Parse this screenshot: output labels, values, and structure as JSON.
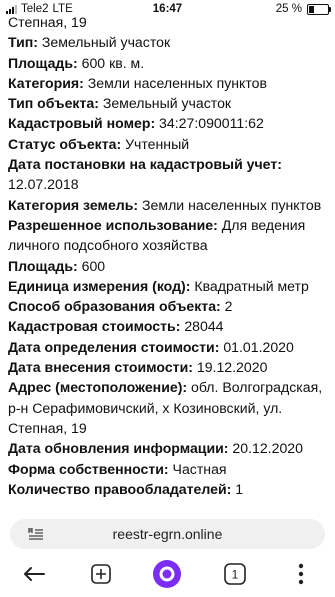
{
  "status_bar": {
    "carrier": "Tele2",
    "network": "LTE",
    "time": "16:47",
    "battery": "25 %",
    "battery_level": 0.25
  },
  "fields": [
    {
      "label": "",
      "value": "Степная, 19"
    },
    {
      "label": "Тип:",
      "value": " Земельный участок"
    },
    {
      "label": "Площадь:",
      "value": " 600 кв. м."
    },
    {
      "label": "Категория:",
      "value": " Земли населенных пунктов"
    },
    {
      "label": "Тип объекта:",
      "value": " Земельный участок"
    },
    {
      "label": "Кадастровый номер:",
      "value": " 34:27:090011:62"
    },
    {
      "label": "Статус объекта:",
      "value": " Учтенный"
    },
    {
      "label": "Дата постановки на кадастровый учет:",
      "value": " 12.07.2018"
    },
    {
      "label": "Категория земель:",
      "value": " Земли населенных пунктов"
    },
    {
      "label": "Разрешенное использование:",
      "value": " Для ведения личного подсобного хозяйства"
    },
    {
      "label": "Площадь:",
      "value": " 600"
    },
    {
      "label": "Единица измерения (код):",
      "value": " Квадратный метр"
    },
    {
      "label": "Способ образования объекта:",
      "value": " 2"
    },
    {
      "label": "Кадастровая стоимость:",
      "value": " 28044"
    },
    {
      "label": "Дата определения стоимости:",
      "value": " 01.01.2020"
    },
    {
      "label": "Дата внесения стоимости:",
      "value": " 19.12.2020"
    },
    {
      "label": "Адрес (местоположение):",
      "value": " обл. Волгоградская, р-н Серафимовичский, х Козиновский, ул. Степная, 19"
    },
    {
      "label": "Дата обновления информации:",
      "value": " 20.12.2020"
    },
    {
      "label": "Форма собственности:",
      "value": " Частная"
    },
    {
      "label": "Количество правообладателей:",
      "value": " 1"
    }
  ],
  "browser": {
    "url": "reestr-egrn.online",
    "tab_count": "1",
    "accent_color": "#7b2cf5"
  }
}
